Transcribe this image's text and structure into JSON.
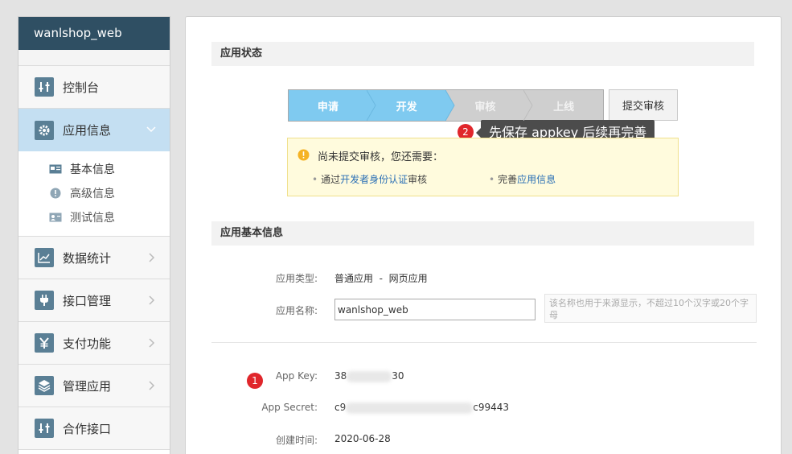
{
  "sidebar": {
    "app_name": "wanlshop_web",
    "items": [
      {
        "label": "控制台",
        "icon": "sliders-icon"
      },
      {
        "label": "应用信息",
        "icon": "gear-icon"
      },
      {
        "label": "数据统计",
        "icon": "chart-icon"
      },
      {
        "label": "接口管理",
        "icon": "plug-icon"
      },
      {
        "label": "支付功能",
        "icon": "yen-icon"
      },
      {
        "label": "管理应用",
        "icon": "layers-icon"
      },
      {
        "label": "合作接口",
        "icon": "sliders-icon"
      }
    ],
    "sub_items": [
      {
        "label": "基本信息",
        "icon": "id-card-icon"
      },
      {
        "label": "高级信息",
        "icon": "exclamation-circle-icon"
      },
      {
        "label": "测试信息",
        "icon": "test-card-icon"
      }
    ]
  },
  "status_section": {
    "title": "应用状态",
    "steps": [
      "申请",
      "开发",
      "审核",
      "上线"
    ],
    "submit_label": "提交审核",
    "tooltip": "先保存 appkey 后续再完善",
    "tooltip_badge": "2",
    "notice": {
      "title": "尚未提交审核，您还需要：",
      "item1_prefix": "通过",
      "item1_link": "开发者身份认证",
      "item1_suffix": "审核",
      "item2_prefix": "完善",
      "item2_link": "应用信息"
    }
  },
  "basic_section": {
    "title": "应用基本信息",
    "type_label": "应用类型:",
    "type_value": "普通应用  -  网页应用",
    "name_label": "应用名称:",
    "name_value": "wanlshop_web",
    "name_hint": "该名称也用于来源显示，不超过10个汉字或20个字母",
    "appkey_badge": "1",
    "appkey_label": "App Key:",
    "appkey_start": "38",
    "appkey_end": "30",
    "secret_label": "App Secret:",
    "secret_start": "c9",
    "secret_end": "c99443",
    "created_label": "创建时间:",
    "created_value": "2020-06-28"
  }
}
